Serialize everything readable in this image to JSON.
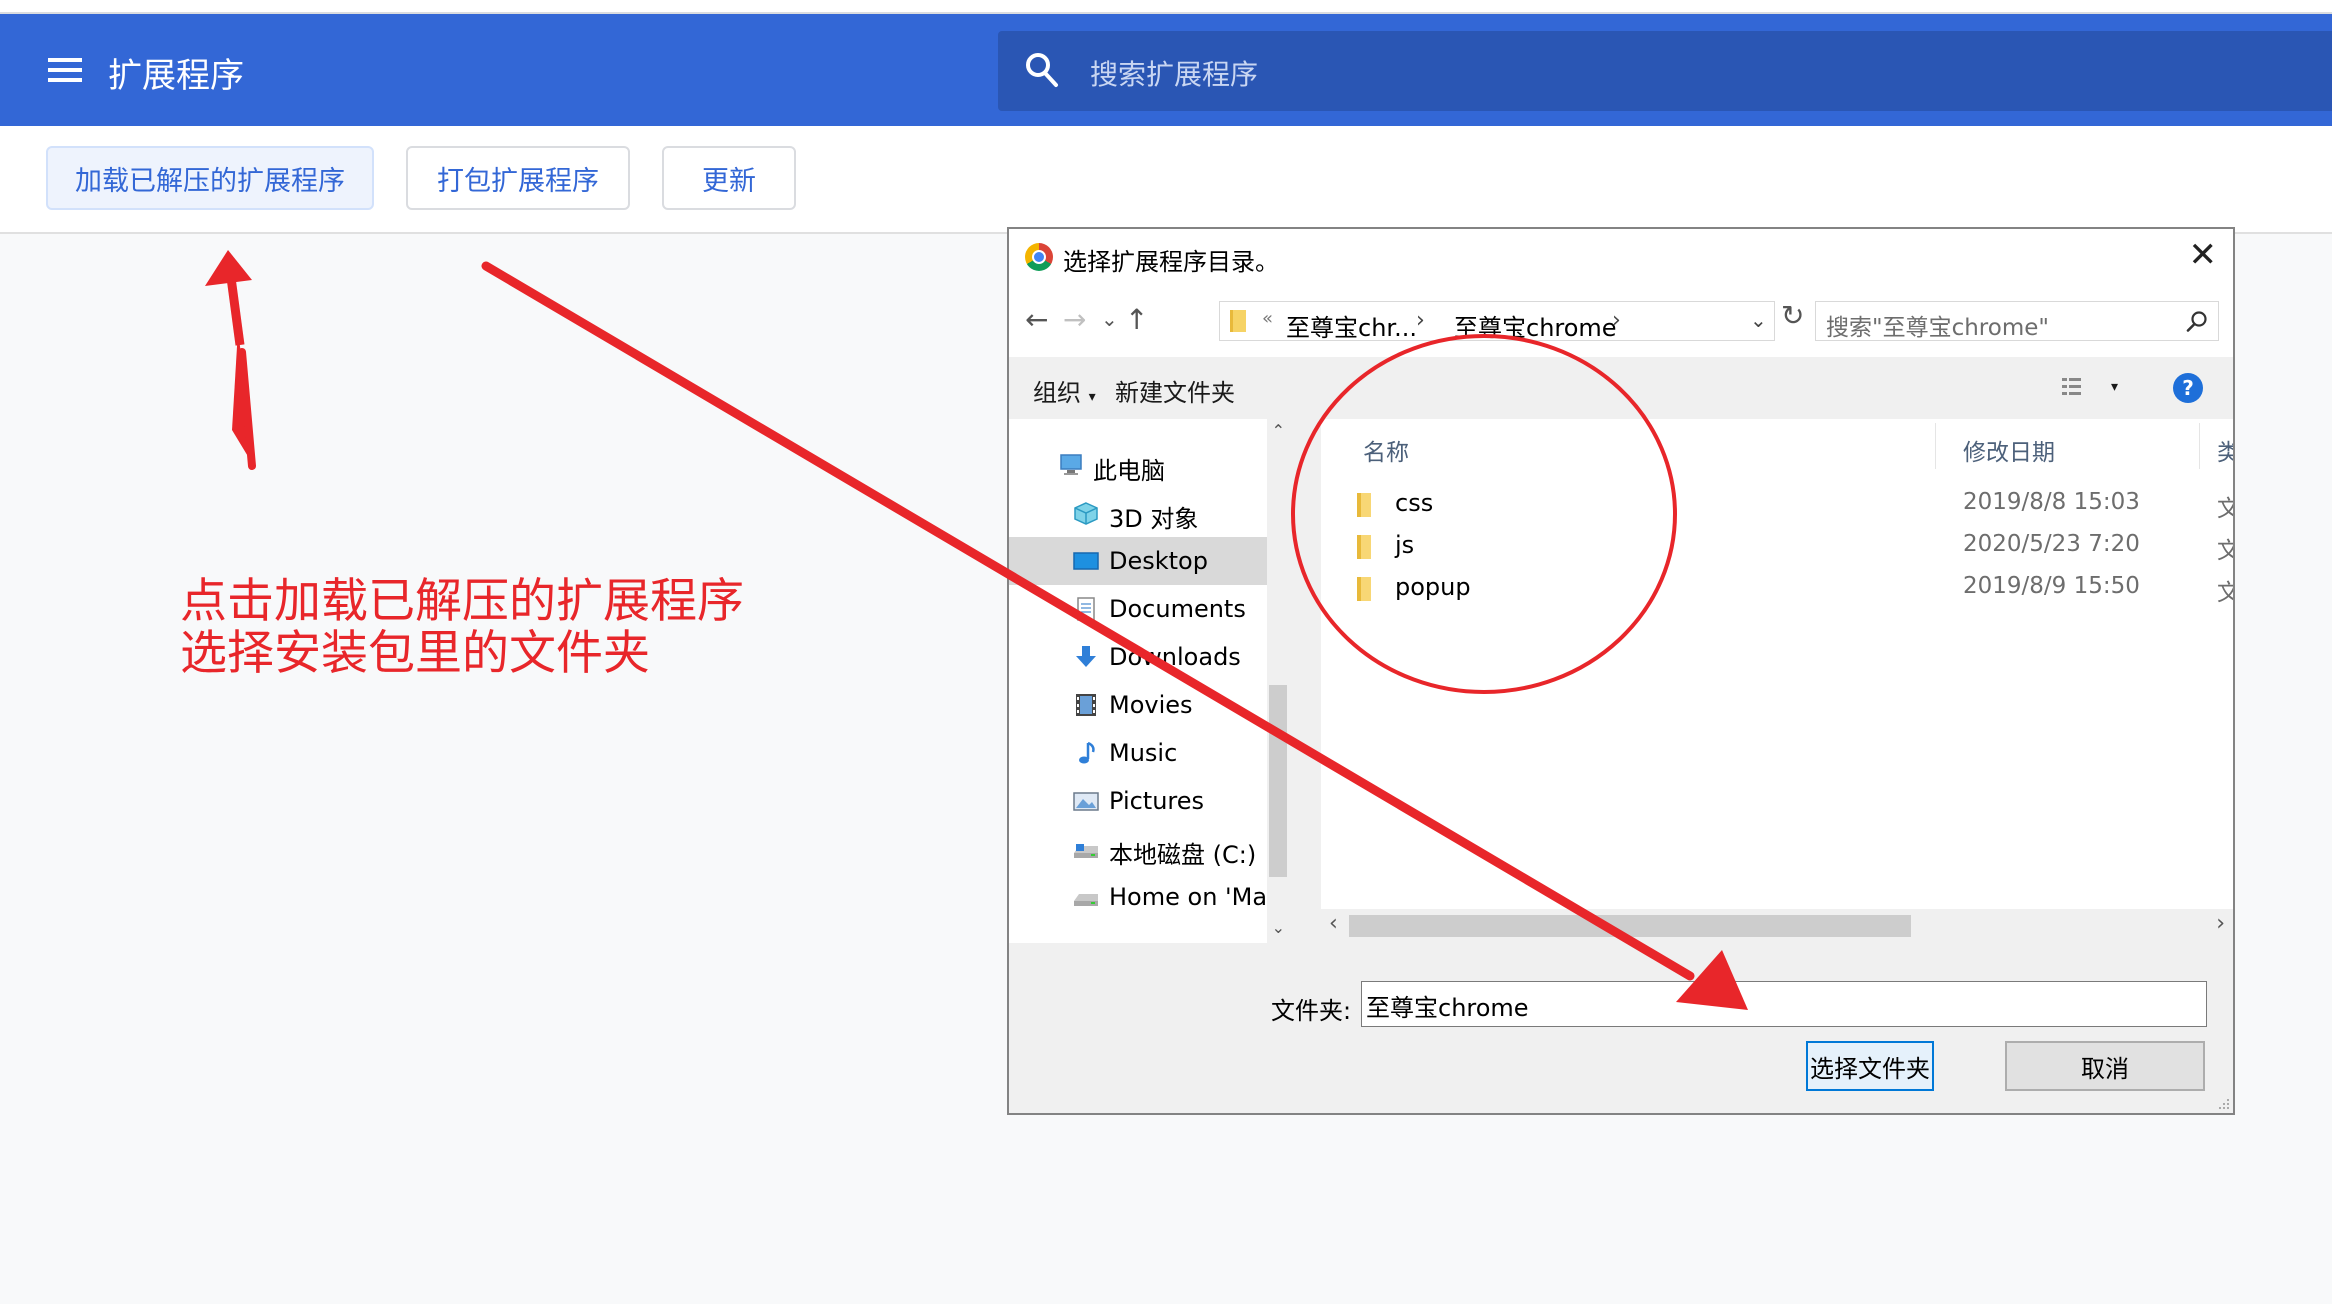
{
  "header": {
    "title": "扩展程序",
    "search_placeholder": "搜索扩展程序"
  },
  "toolbar": {
    "load_unpacked": "加载已解压的扩展程序",
    "pack": "打包扩展程序",
    "update": "更新"
  },
  "annotation": {
    "line1": "点击加载已解压的扩展程序",
    "line2": "选择安装包里的文件夹"
  },
  "dialog": {
    "title": "选择扩展程序目录。",
    "address": {
      "overflow": "«",
      "segments": [
        "至尊宝chr...",
        "至尊宝chrome"
      ]
    },
    "search_placeholder": "搜索\"至尊宝chrome\"",
    "commands": {
      "organize": "组织",
      "new_folder": "新建文件夹"
    },
    "nav": [
      {
        "label": "此电脑",
        "icon": "pc-icon"
      },
      {
        "label": "3D 对象",
        "icon": "3d-objects-icon"
      },
      {
        "label": "Desktop",
        "icon": "desktop-icon"
      },
      {
        "label": "Documents",
        "icon": "documents-icon"
      },
      {
        "label": "Downloads",
        "icon": "downloads-icon"
      },
      {
        "label": "Movies",
        "icon": "movies-icon"
      },
      {
        "label": "Music",
        "icon": "music-icon"
      },
      {
        "label": "Pictures",
        "icon": "pictures-icon"
      },
      {
        "label": "本地磁盘 (C:)",
        "icon": "drive-icon"
      },
      {
        "label": "Home on 'Mac'",
        "icon": "network-drive-icon"
      }
    ],
    "columns": {
      "name": "名称",
      "date": "修改日期",
      "type": "类"
    },
    "files": [
      {
        "name": "css",
        "date": "2019/8/8 15:03",
        "type": "文"
      },
      {
        "name": "js",
        "date": "2020/5/23 7:20",
        "type": "文"
      },
      {
        "name": "popup",
        "date": "2019/8/9 15:50",
        "type": "文"
      }
    ],
    "folder_label": "文件夹:",
    "folder_value": "至尊宝chrome",
    "select_button": "选择文件夹",
    "cancel_button": "取消"
  },
  "colors": {
    "header_blue": "#3367d6",
    "search_blue": "#2a56b4",
    "annotation_red": "#e8262a"
  }
}
